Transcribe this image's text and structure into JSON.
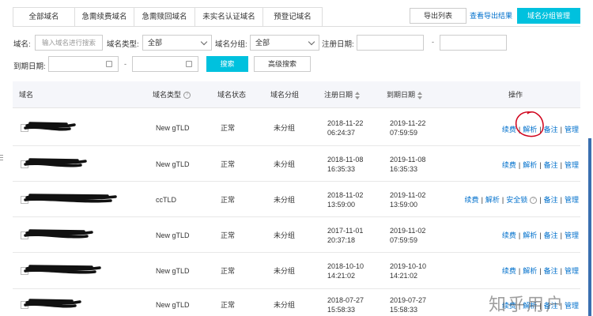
{
  "tabs": [
    "全部域名",
    "急需续费域名",
    "急需赎回域名",
    "未实名认证域名",
    "预登记域名"
  ],
  "toolbar": {
    "export_label": "导出列表",
    "view_export_label": "查看导出结果",
    "group_manage_label": "域名分组管理"
  },
  "filters": {
    "domain_label": "域名:",
    "domain_placeholder": "输入域名进行搜索",
    "type_label": "域名类型:",
    "type_value": "全部",
    "group_label": "域名分组:",
    "group_value": "全部",
    "reg_date_label": "注册日期:",
    "exp_date_label": "到期日期:",
    "range_sep": "-",
    "search_label": "搜索",
    "advanced_label": "高级搜索"
  },
  "table": {
    "headers": {
      "domain": "域名",
      "type": "域名类型",
      "status": "域名状态",
      "group": "域名分组",
      "reg_date": "注册日期",
      "exp_date": "到期日期",
      "ops": "操作"
    },
    "rows": [
      {
        "type": "New gTLD",
        "status": "正常",
        "group": "未分组",
        "reg_date": "2018-11-22",
        "reg_time": "06:24:37",
        "exp_date": "2019-11-22",
        "exp_time": "07:59:59",
        "ops": [
          "续费",
          "解析",
          "备注",
          "管理"
        ]
      },
      {
        "type": "New gTLD",
        "status": "正常",
        "group": "未分组",
        "reg_date": "2018-11-08",
        "reg_time": "16:35:33",
        "exp_date": "2019-11-08",
        "exp_time": "16:35:33",
        "ops": [
          "续费",
          "解析",
          "备注",
          "管理"
        ]
      },
      {
        "type": "ccTLD",
        "status": "正常",
        "group": "未分组",
        "reg_date": "2018-11-02",
        "reg_time": "13:59:00",
        "exp_date": "2019-11-02",
        "exp_time": "13:59:00",
        "ops": [
          "续费",
          "解析",
          "安全锁",
          "备注",
          "管理"
        ]
      },
      {
        "type": "New gTLD",
        "status": "正常",
        "group": "未分组",
        "reg_date": "2017-11-01",
        "reg_time": "20:37:18",
        "exp_date": "2019-11-02",
        "exp_time": "07:59:59",
        "ops": [
          "续费",
          "解析",
          "备注",
          "管理"
        ]
      },
      {
        "type": "New gTLD",
        "status": "正常",
        "group": "未分组",
        "reg_date": "2018-10-10",
        "reg_time": "14:21:02",
        "exp_date": "2019-10-10",
        "exp_time": "14:21:02",
        "ops": [
          "续费",
          "解析",
          "备注",
          "管理"
        ]
      },
      {
        "type": "New gTLD",
        "status": "正常",
        "group": "未分组",
        "reg_date": "2018-07-27",
        "reg_time": "15:58:33",
        "exp_date": "2019-07-27",
        "exp_time": "15:58:33",
        "ops": [
          "续费",
          "解析",
          "备注",
          "管理"
        ]
      }
    ]
  },
  "watermark": "知乎用户",
  "colors": {
    "accent": "#00c1de",
    "link": "#0070cc",
    "annotation": "#d0021b"
  }
}
